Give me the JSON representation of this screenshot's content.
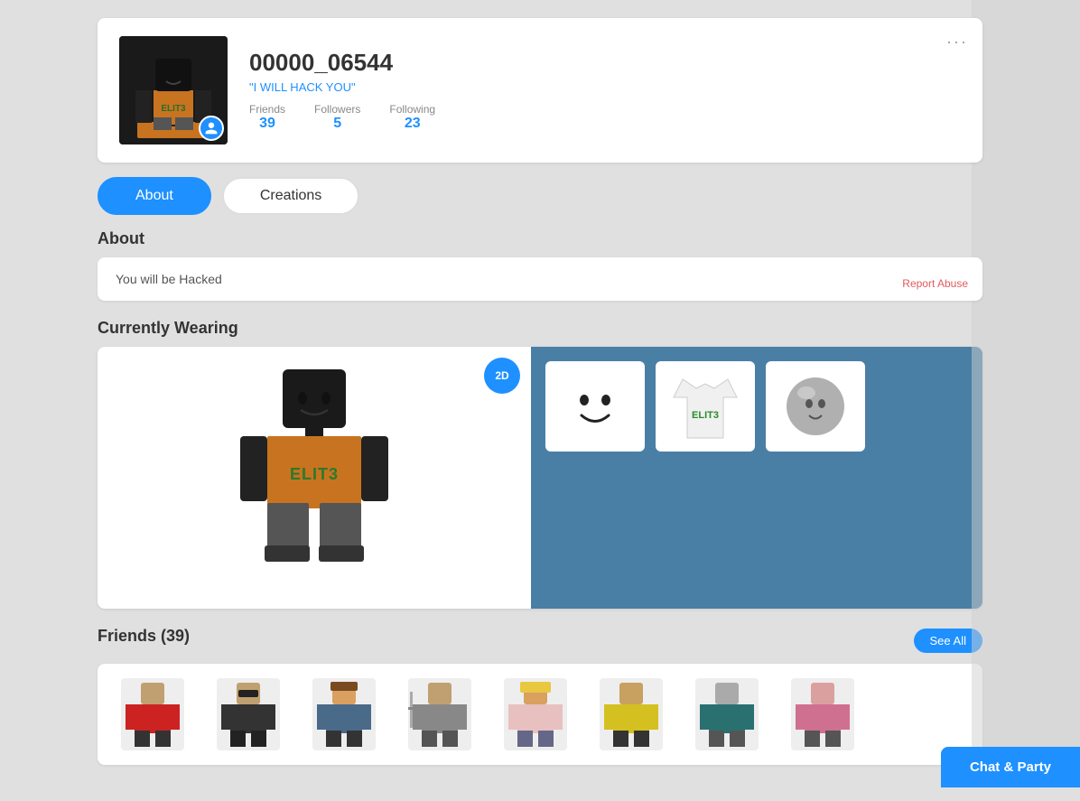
{
  "profile": {
    "username": "00000_06544",
    "status": "\"I WILL HACK YOU\"",
    "friends_label": "Friends",
    "friends_count": "39",
    "followers_label": "Followers",
    "followers_count": "5",
    "following_label": "Following",
    "following_count": "23",
    "more_menu_label": "···"
  },
  "tabs": {
    "about_label": "About",
    "creations_label": "Creations"
  },
  "about": {
    "heading": "About",
    "text": "You will be Hacked",
    "report_label": "Report Abuse"
  },
  "wearing": {
    "heading": "Currently Wearing",
    "badge_label": "2D"
  },
  "friends": {
    "heading": "Friends (39)",
    "see_all_label": "See All"
  },
  "chat_bar": {
    "label": "Chat & Party"
  }
}
